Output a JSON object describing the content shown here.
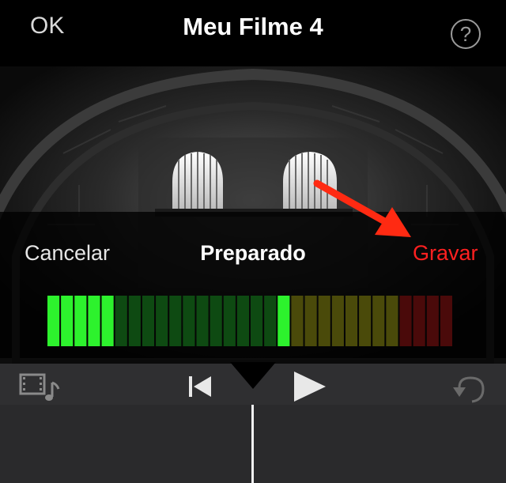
{
  "header": {
    "ok_label": "OK",
    "title": "Meu Filme 4",
    "help_icon_glyph": "?"
  },
  "recording": {
    "cancel_label": "Cancelar",
    "status_label": "Preparado",
    "record_label": "Gravar",
    "record_color": "#ff2020"
  },
  "level_meter": {
    "segments_total": 30,
    "active_level_segment": 17,
    "colors": {
      "green_active": "#2df22d",
      "green_dim": "#0e4a12",
      "yellow_dim": "#4a4a0a",
      "red_dim": "#4a0a0a"
    }
  },
  "annotation": {
    "arrow_color": "#ff2a12",
    "points_to": "Gravar"
  },
  "toolbar": {
    "media_icon": "film-music-icon",
    "skip_icon": "skip-back-icon",
    "play_icon": "play-icon",
    "undo_icon": "undo-icon"
  }
}
